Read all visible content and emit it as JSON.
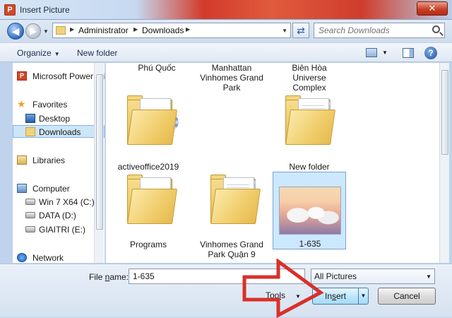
{
  "window": {
    "title": "Insert Picture",
    "app_icon_letter": "P",
    "close_glyph": "✕"
  },
  "address": {
    "segments": [
      "Administrator",
      "Downloads"
    ],
    "search_placeholder": "Search Downloads"
  },
  "toolbar": {
    "organize": "Organize",
    "new_folder": "New folder",
    "help": "?"
  },
  "sidebar": {
    "items": [
      {
        "label": "Microsoft PowerPoint",
        "icon": "powerpoint-icon"
      },
      {
        "label": "Favorites",
        "icon": "star-icon"
      },
      {
        "label": "Desktop",
        "icon": "desktop-icon"
      },
      {
        "label": "Downloads",
        "icon": "downloads-folder-icon",
        "selected": true
      },
      {
        "label": "Libraries",
        "icon": "library-icon"
      },
      {
        "label": "Computer",
        "icon": "computer-icon"
      },
      {
        "label": "Win 7 X64 (C:)",
        "icon": "drive-icon"
      },
      {
        "label": "DATA (D:)",
        "icon": "drive-icon"
      },
      {
        "label": "GIAITRI (E:)",
        "icon": "drive-icon"
      },
      {
        "label": "Network",
        "icon": "network-icon"
      }
    ]
  },
  "files": [
    {
      "name": "Phú Quốc",
      "kind": "folder"
    },
    {
      "name": "Manhattan Vinhomes Grand Park",
      "kind": "folder",
      "lines": [
        "Manhattan",
        "Vinhomes Grand",
        "Park"
      ]
    },
    {
      "name": "Biên Hòa Universe Complex",
      "kind": "folder",
      "lines": [
        "Biên Hòa",
        "Universe",
        "Complex"
      ]
    },
    {
      "name": "activeoffice2019",
      "kind": "folder"
    },
    {
      "name": "New folder",
      "kind": "folder"
    },
    {
      "name": "Programs",
      "kind": "folder"
    },
    {
      "name": "Vinhomes Grand Park Quận 9",
      "kind": "folder",
      "lines": [
        "Vinhomes Grand",
        "Park Quận 9"
      ]
    },
    {
      "name": "1-635",
      "kind": "image",
      "selected": true
    }
  ],
  "footer": {
    "file_name_label_pre": "File ",
    "file_name_label_accel": "n",
    "file_name_label_post": "ame:",
    "file_name_value": "1-635",
    "filter_value": "All Pictures",
    "tools_pre": "Too",
    "tools_accel": "l",
    "tools_post": "s",
    "insert_pre": "In",
    "insert_accel": "s",
    "insert_post": "ert",
    "cancel": "Cancel"
  },
  "colors": {
    "annotation_arrow": "#d9302a",
    "selection": "#cce8ff"
  }
}
